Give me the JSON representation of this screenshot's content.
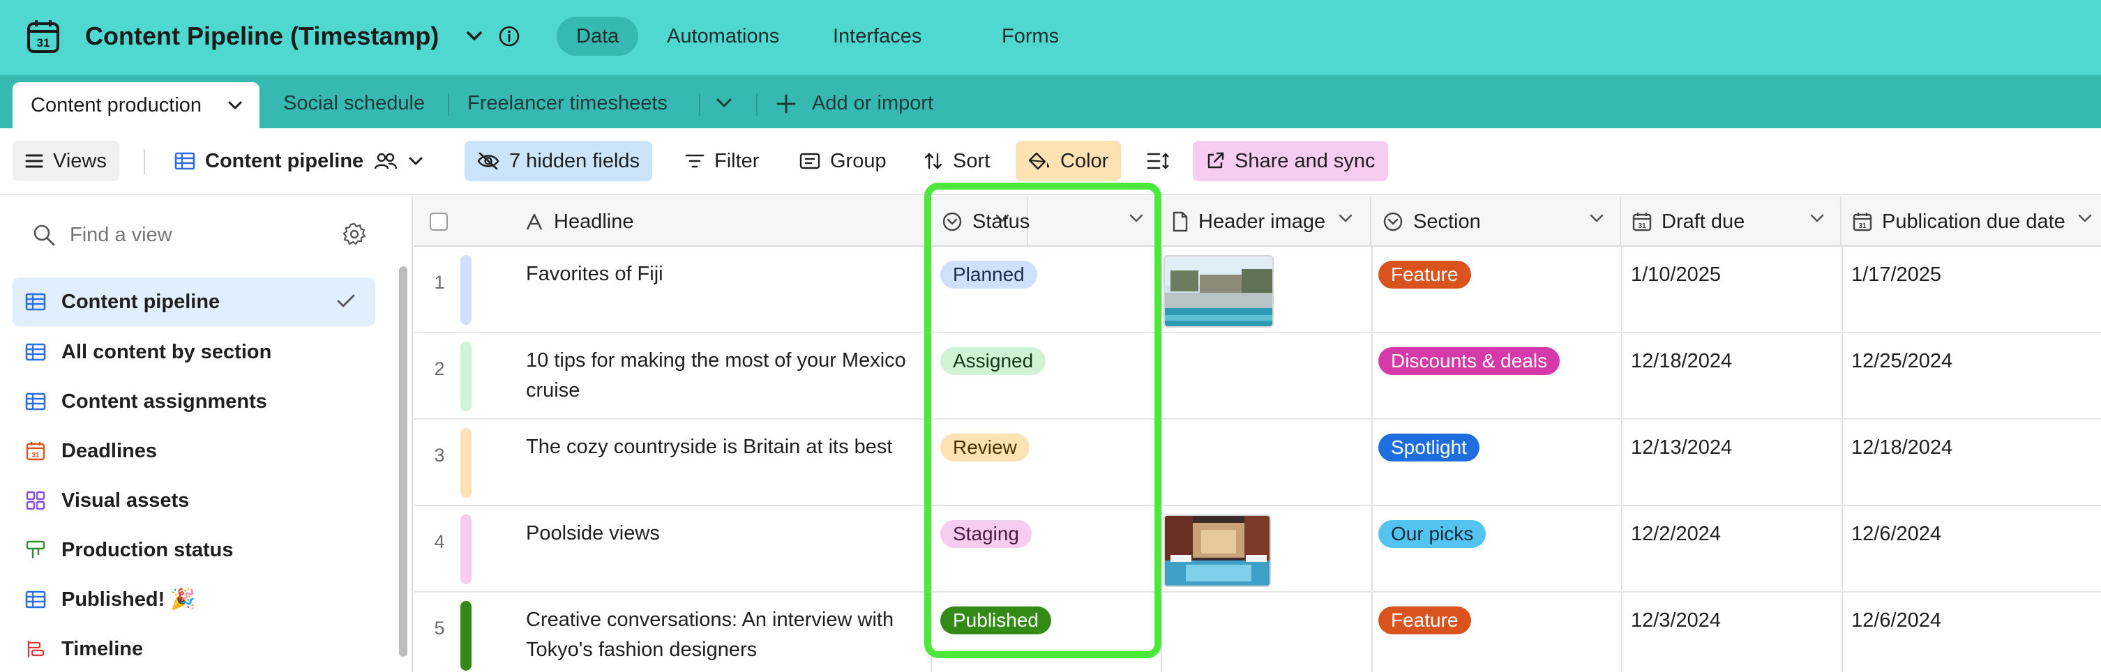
{
  "app": {
    "title": "Content Pipeline (Timestamp)",
    "nav": [
      "Data",
      "Automations",
      "Interfaces",
      "Forms"
    ]
  },
  "tabs": {
    "active": "Content production",
    "others": [
      "Social schedule",
      "Freelancer timesheets"
    ],
    "add": "Add or import"
  },
  "toolbar": {
    "views": "Views",
    "view_name": "Content pipeline",
    "hidden_fields": "7 hidden fields",
    "filter": "Filter",
    "group": "Group",
    "sort": "Sort",
    "color": "Color",
    "share": "Share and sync"
  },
  "sidebar": {
    "search_placeholder": "Find a view",
    "items": [
      {
        "label": "Content pipeline",
        "icon": "grid-icon",
        "active": true
      },
      {
        "label": "All content by section",
        "icon": "grid-icon"
      },
      {
        "label": "Content assignments",
        "icon": "grid-icon"
      },
      {
        "label": "Deadlines",
        "icon": "calendar-icon"
      },
      {
        "label": "Visual assets",
        "icon": "gallery-icon"
      },
      {
        "label": "Production status",
        "icon": "kanban-icon"
      },
      {
        "label": "Published! 🎉",
        "icon": "grid-icon"
      },
      {
        "label": "Timeline",
        "icon": "timeline-icon"
      }
    ]
  },
  "grid": {
    "columns": [
      "Headline",
      "Status",
      "Header image",
      "Section",
      "Draft due",
      "Publication due date"
    ],
    "rows": [
      {
        "num": "1",
        "headline": "Favorites of Fiji",
        "status": "Planned",
        "section": "Feature",
        "draft": "1/10/2025",
        "pub": "1/17/2025"
      },
      {
        "num": "2",
        "headline": "10 tips for making the most of your Mexico cruise",
        "status": "Assigned",
        "section": "Discounts & deals",
        "draft": "12/18/2024",
        "pub": "12/25/2024"
      },
      {
        "num": "3",
        "headline": "The cozy countryside is Britain at its best",
        "status": "Review",
        "section": "Spotlight",
        "draft": "12/13/2024",
        "pub": "12/18/2024"
      },
      {
        "num": "4",
        "headline": "Poolside views",
        "status": "Staging",
        "section": "Our picks",
        "draft": "12/2/2024",
        "pub": "12/6/2024"
      },
      {
        "num": "5",
        "headline": "Creative conversations: An interview with Tokyo's fashion designers",
        "status": "Published",
        "section": "Feature",
        "draft": "12/3/2024",
        "pub": "12/6/2024"
      }
    ]
  },
  "colors": {
    "topbar": "#4fd8d0",
    "tabbar": "#36b9b1",
    "highlight": "#4ce83c",
    "status": {
      "Planned": "#cfe0fc",
      "Assigned": "#d1f3d5",
      "Review": "#fde3b4",
      "Staging": "#f6ccf1",
      "Published": "#338a17"
    },
    "section": {
      "Feature": "#d9531e",
      "Discounts & deals": "#d63aa9",
      "Spotlight": "#1f6ee0",
      "Our picks": "#54c3f0"
    }
  }
}
